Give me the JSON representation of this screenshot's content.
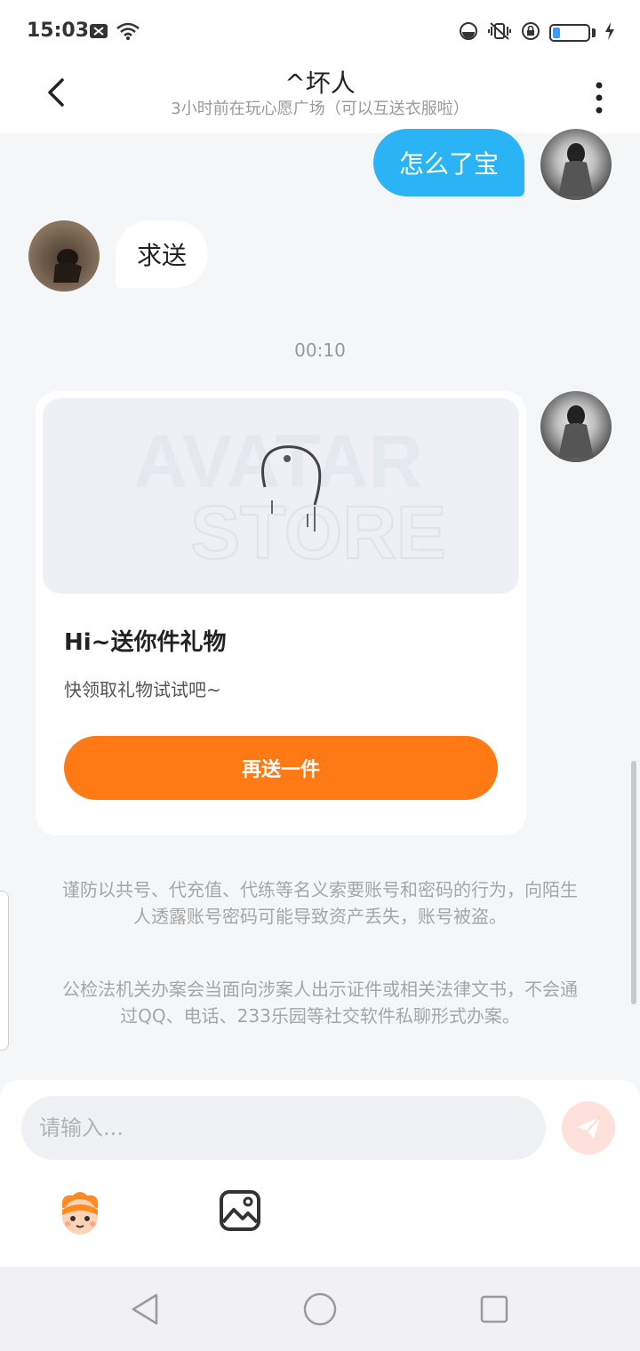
{
  "status_bar": {
    "time": "15:03",
    "left_icons": [
      "sim-off-icon",
      "wifi-icon"
    ],
    "right_icons": [
      "data-saver-icon",
      "vibrate-icon",
      "screen-lock-icon",
      "battery-icon",
      "charging-icon"
    ],
    "battery_level": 0.2
  },
  "header": {
    "title": "^坏人",
    "subtitle": "3小时前在玩心愿广场（可以互送衣服啦）"
  },
  "messages": [
    {
      "side": "right",
      "text": "怎么了宝"
    },
    {
      "side": "left",
      "text": "求送"
    }
  ],
  "timestamp": "00:10",
  "gift_card": {
    "image_watermark": [
      "AVATAR",
      "STORE"
    ],
    "title": "Hi~送你件礼物",
    "desc": "快领取礼物试试吧~",
    "button_label": "再送一件"
  },
  "notices": [
    "谨防以共号、代充值、代练等名义索要账号和密码的行为，向陌生人透露账号密码可能导致资产丢失，账号被盗。",
    "公检法机关办案会当面向涉案人出示证件或相关法律文书，不会通过QQ、电话、233乐园等社交软件私聊形式办案。"
  ],
  "input": {
    "placeholder": "请输入..."
  },
  "colors": {
    "accent_blue": "#2bb4f5",
    "accent_orange": "#ff7a14"
  }
}
